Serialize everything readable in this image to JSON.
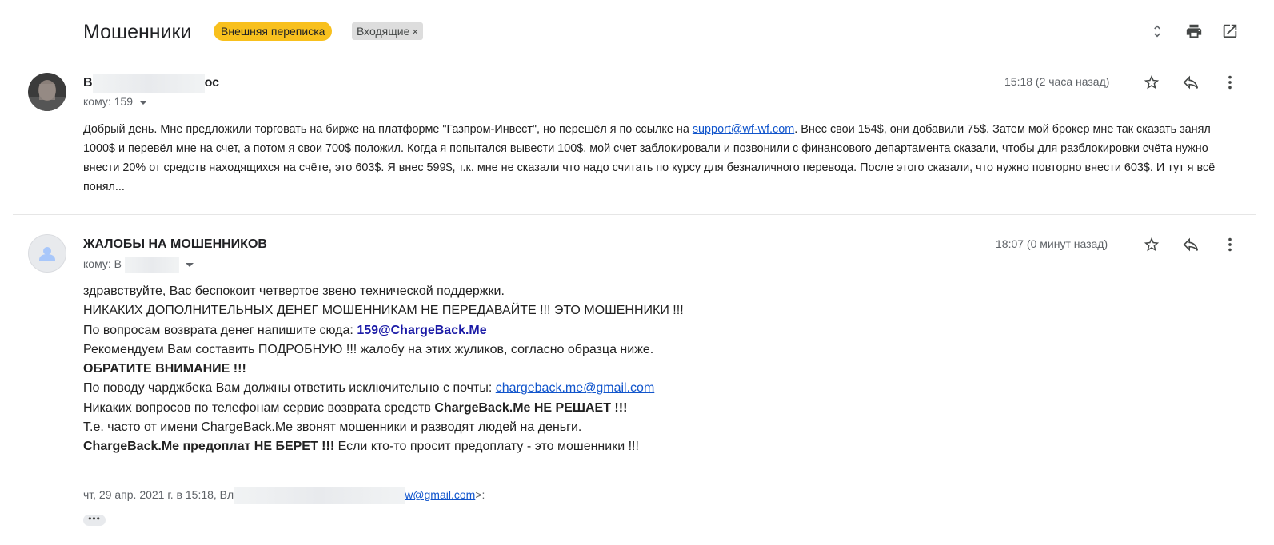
{
  "thread": {
    "subject": "Мошенники",
    "labels": {
      "external": "Внешняя переписка",
      "inbox": "Входящие",
      "remove": "×"
    }
  },
  "colors": {
    "external_label_bg": "#f8c01d",
    "link": "#1155cc",
    "highlight_email": "#1a1aa6"
  },
  "icons": {
    "expand": "unfold-icon",
    "print": "printer-icon",
    "popout": "open-in-new-icon",
    "star": "star-icon",
    "reply": "reply-icon",
    "more": "more-vert-icon"
  },
  "message1": {
    "sender_start": "В",
    "sender_end": "ос",
    "recipient": "кому: 159",
    "time": "15:18 (2 часа назад)",
    "snippet_before_link": "Добрый день. Мне предложили торговать на бирже на платформе \"Газпром-Инвест\", но перешёл я по ссылке на ",
    "snippet_link": "support@wf-wf.com",
    "snippet_after_link": ". Внес свои 154$, они добавили 75$. Затем мой брокер мне так сказать занял 1000$ и перевёл мне на счет, а потом я свои 700$ положил. Когда я попытался вывести 100$, мой счет заблокировали и позвонили с финансового департамента сказали, чтобы для разблокировки счёта нужно внести 20% от средств находящихся на счёте, это 603$. Я внес 599$, т.к. мне не сказали что надо считать по курсу для безналичного перевода. После этого сказали, что нужно повторно внести 603$. И тут я всё понял..."
  },
  "message2": {
    "sender": "ЖАЛОБЫ НА МОШЕННИКОВ",
    "recipient": "кому: В",
    "time": "18:07 (0 минут назад)",
    "lines": {
      "l1": "здравствуйте, Вас беспокоит четвертое звено технической поддержки.",
      "l2": "НИКАКИХ ДОПОЛНИТЕЛЬНЫХ ДЕНЕГ МОШЕННИКАМ НЕ ПЕРЕДАВАЙТЕ !!! ЭТО МОШЕННИКИ !!!",
      "l3_prefix": "По вопросам возврата денег напишите сюда: ",
      "l3_email": "159@ChargeBack.Me",
      "l4": "Рекомендуем Вам составить ПОДРОБНУЮ !!! жалобу на этих жуликов, согласно образца ниже.",
      "l5": "ОБРАТИТЕ ВНИМАНИЕ !!!",
      "l6_prefix": "По поводу чарджбека Вам должны ответить исключительно с почты: ",
      "l6_link": "chargeback.me@gmail.com",
      "l7_prefix": "Никаких вопросов по телефонам сервис возврата средств ",
      "l7_bold": "ChargeBack.Me НЕ РЕШАЕТ !!!",
      "l8": "Т.е. часто от имени ChargeBack.Me звонят мошенники и разводят людей на деньги.",
      "l9_bold": "ChargeBack.Me предоплат НЕ БЕРЕТ !!!",
      "l9_rest": " Если кто-то просит предоплату - это мошенники !!!"
    },
    "quote_prefix": "чт, 29 апр. 2021 г. в 15:18, Вл",
    "quote_email_tail": "w@gmail.com",
    "quote_suffix": ">:",
    "ellipsis": "•••"
  }
}
